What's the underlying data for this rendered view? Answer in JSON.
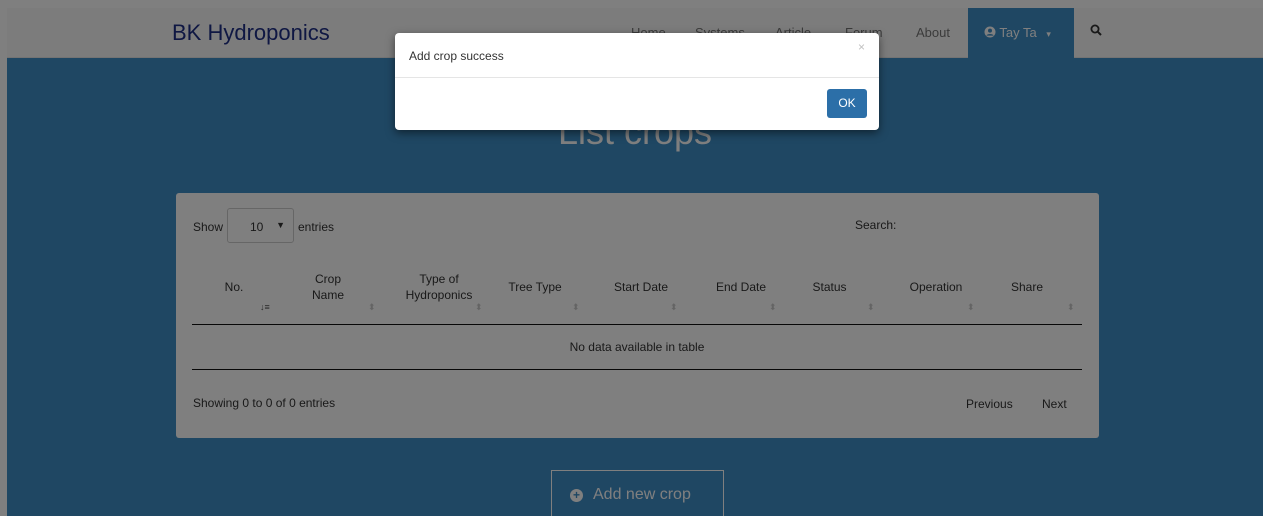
{
  "navbar": {
    "brand": "BK Hydroponics",
    "links": [
      "Home",
      "Systems",
      "Article",
      "Forum",
      "About"
    ],
    "user_name": "Tay Ta",
    "user_icon": "user-circle-icon",
    "caret": "▾",
    "search_icon": "search-icon"
  },
  "page_title": "List crops",
  "table": {
    "show_label": "Show",
    "length_value": "10",
    "entries_label": "entries",
    "search_label": "Search:",
    "columns": [
      "No.",
      "Crop Name",
      "Type of Hydroponics",
      "Tree Type",
      "Start Date",
      "End Date",
      "Status",
      "Operation",
      "Share"
    ],
    "empty_text": "No data available in table",
    "info_text": "Showing 0 to 0 of 0 entries",
    "previous_label": "Previous",
    "next_label": "Next"
  },
  "add_button_label": "Add new crop",
  "modal": {
    "title": "Add crop success",
    "close": "×",
    "ok_label": "OK"
  },
  "colors": {
    "accent": "#3f8fc7",
    "brand": "#1f2f86",
    "ok_button": "#2c6fa8"
  }
}
